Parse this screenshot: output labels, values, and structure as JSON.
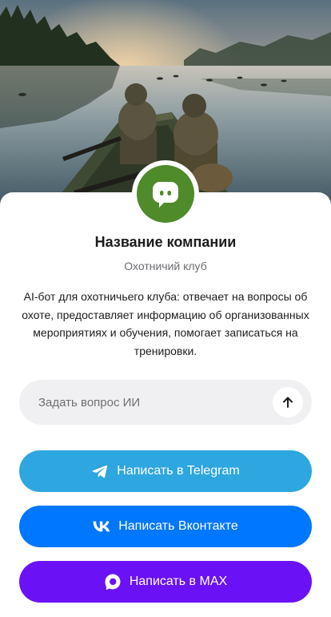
{
  "company": {
    "name": "Название компании",
    "type": "Охотничий клуб",
    "description": "AI-бот для охотничьего клуба: отвечает на вопросы об охоте, предоставляет информацию об организованных мероприятиях и обучения, помогает записаться на тренировки.",
    "avatar_icon": "chat-bot-icon",
    "avatar_color": "#4f8a2b"
  },
  "hero": {
    "image": "hunters-in-boat-on-misty-lake"
  },
  "ai_chat": {
    "placeholder": "Задать вопрос ИИ",
    "send_icon": "arrow-up-icon"
  },
  "buttons": {
    "telegram": {
      "label": "Написать в Telegram",
      "icon": "telegram-icon",
      "color": "#2ea6e0"
    },
    "vk": {
      "label": "Написать Вконтакте",
      "icon": "vk-icon",
      "color": "#0077ff"
    },
    "max": {
      "label": "Написать в MAX",
      "icon": "max-icon",
      "color": "#6a12f5"
    }
  }
}
